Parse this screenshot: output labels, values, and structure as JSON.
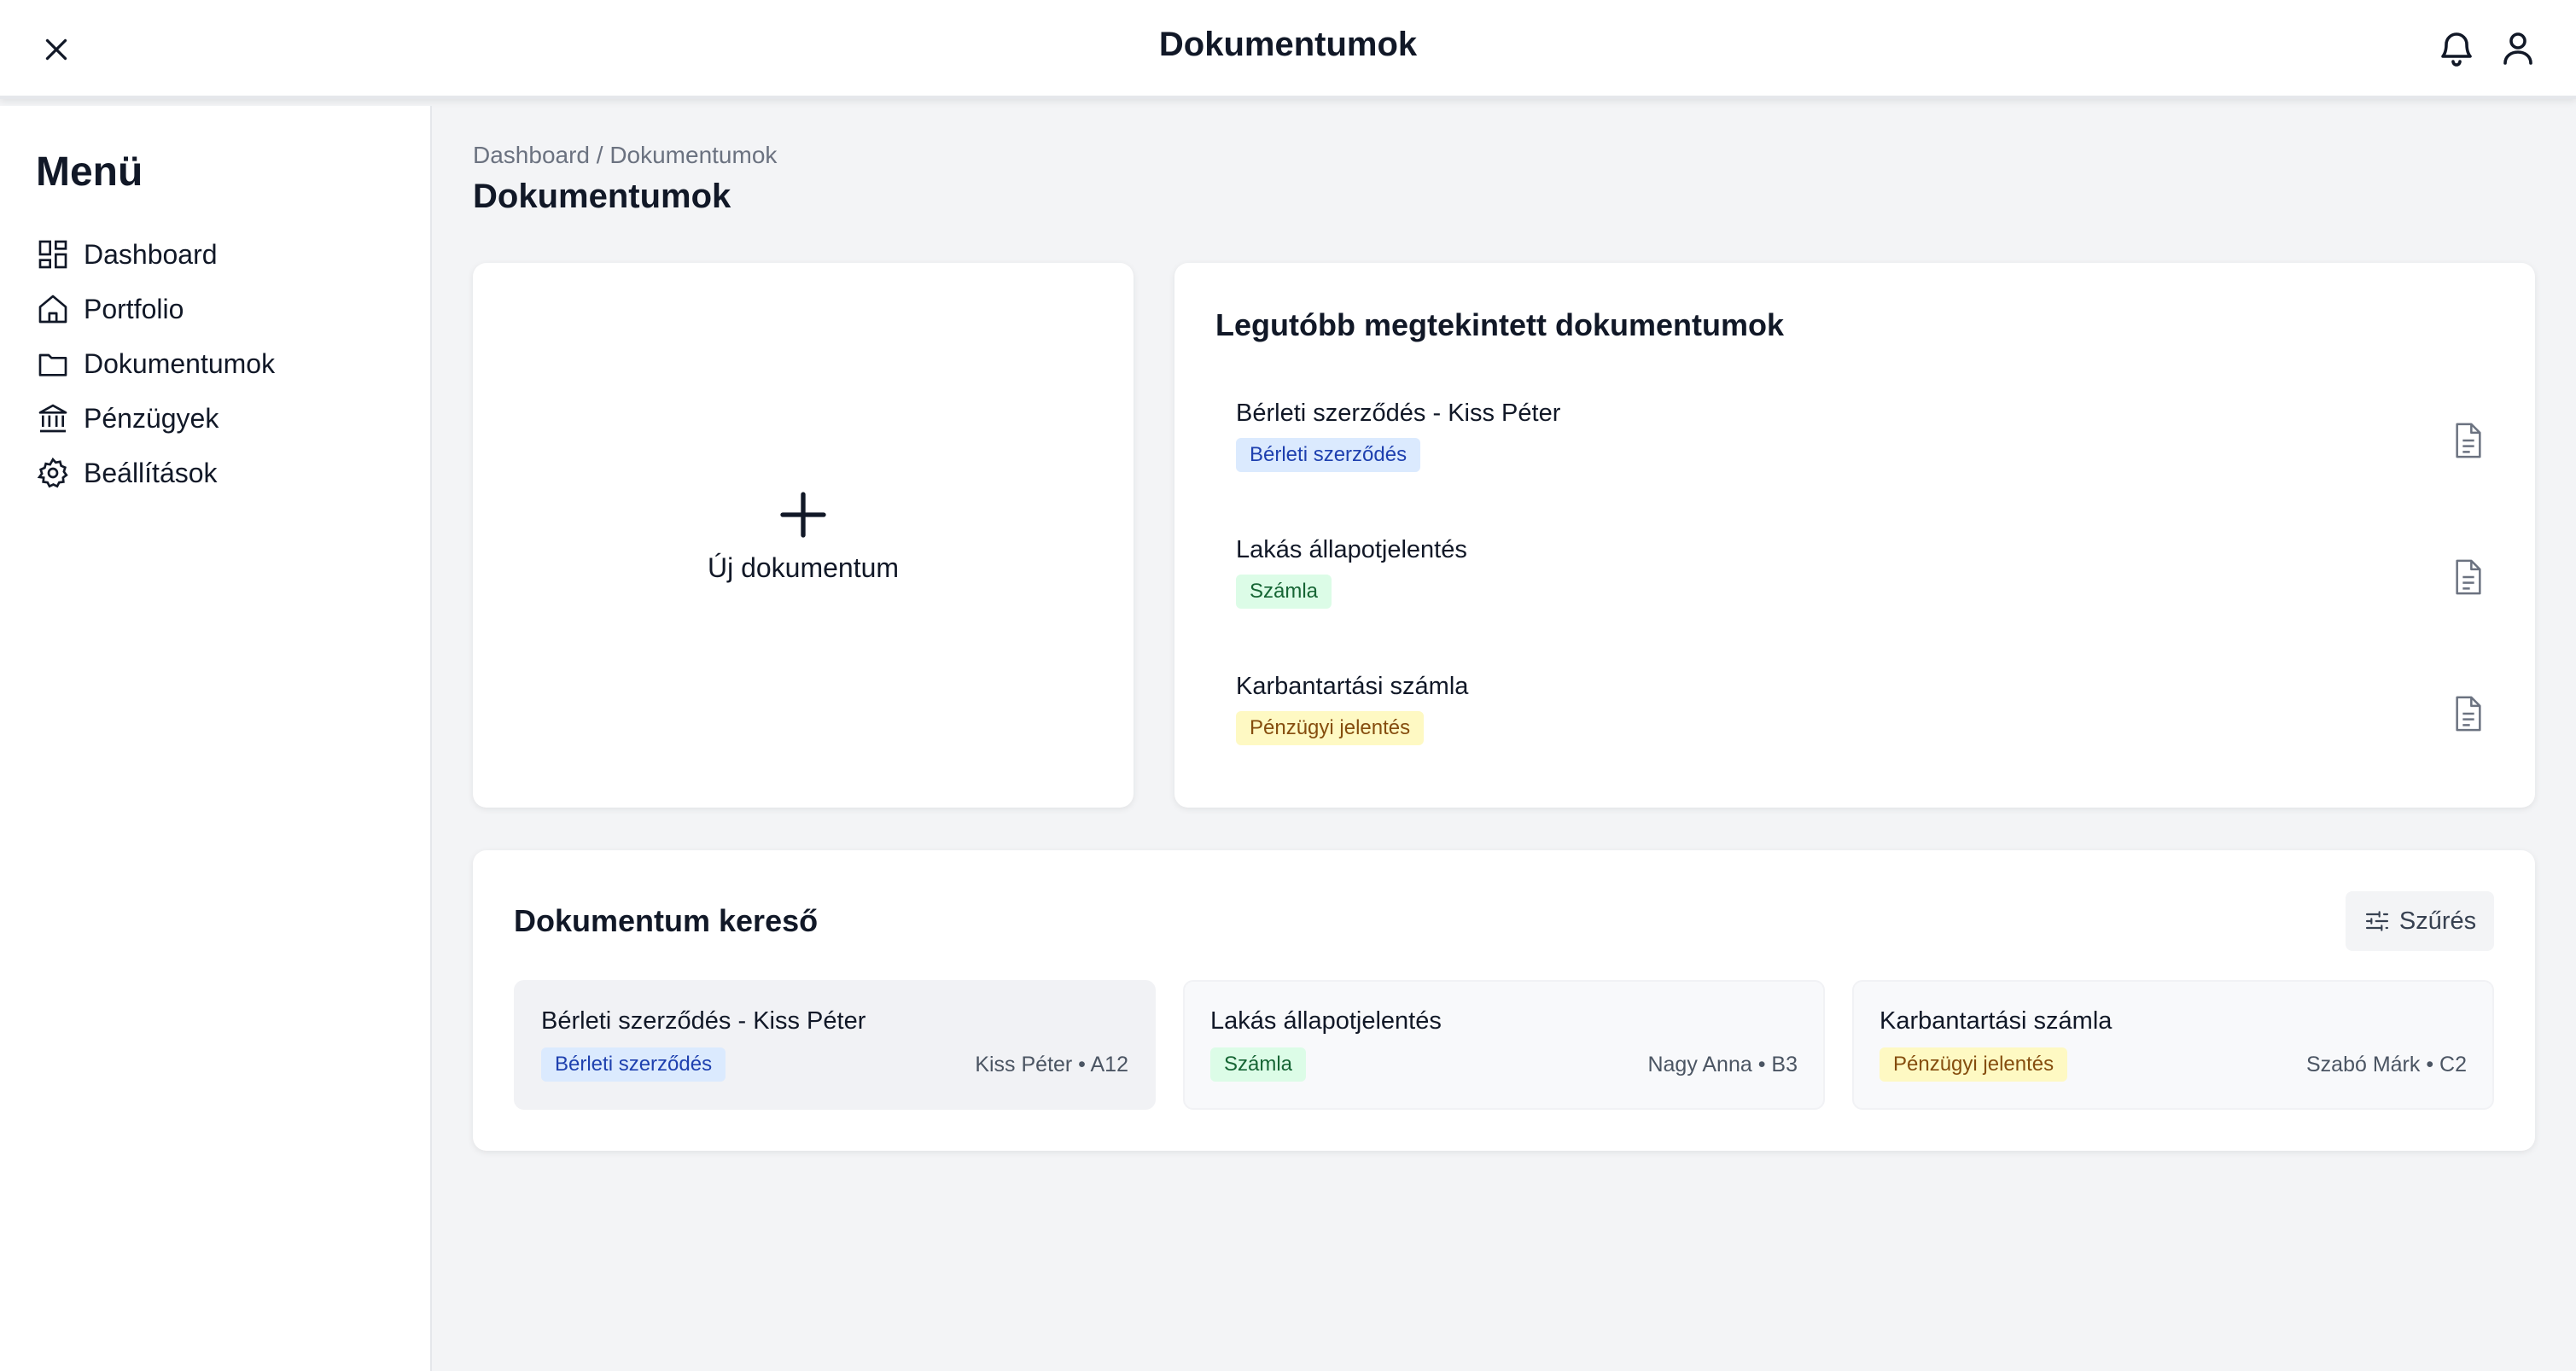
{
  "header": {
    "title": "Dokumentumok"
  },
  "sidebar": {
    "heading": "Menü",
    "items": [
      {
        "label": "Dashboard",
        "icon": "dashboard-icon"
      },
      {
        "label": "Portfolio",
        "icon": "home-icon"
      },
      {
        "label": "Dokumentumok",
        "icon": "folder-icon"
      },
      {
        "label": "Pénzügyek",
        "icon": "bank-icon"
      },
      {
        "label": "Beállítások",
        "icon": "gear-icon"
      }
    ]
  },
  "breadcrumb": "Dashboard / Dokumentumok",
  "page_title": "Dokumentumok",
  "new_document": {
    "label": "Új dokumentum"
  },
  "recent": {
    "title": "Legutóbb megtekintett dokumentumok",
    "items": [
      {
        "name": "Bérleti szerződés - Kiss Péter",
        "tag": "Bérleti szerződés",
        "tag_color": "blue"
      },
      {
        "name": "Lakás állapotjelentés",
        "tag": "Számla",
        "tag_color": "green"
      },
      {
        "name": "Karbantartási számla",
        "tag": "Pénzügyi jelentés",
        "tag_color": "yellow"
      }
    ]
  },
  "search": {
    "title": "Dokumentum kereső",
    "filter_label": "Szűrés",
    "results": [
      {
        "name": "Bérleti szerződés - Kiss Péter",
        "tag": "Bérleti szerződés",
        "tag_color": "blue",
        "meta": "Kiss Péter • A12"
      },
      {
        "name": "Lakás állapotjelentés",
        "tag": "Számla",
        "tag_color": "green",
        "meta": "Nagy Anna • B3"
      },
      {
        "name": "Karbantartási számla",
        "tag": "Pénzügyi jelentés",
        "tag_color": "yellow",
        "meta": "Szabó Márk • C2"
      }
    ]
  },
  "colors": {
    "background": "#f3f4f6",
    "card": "#ffffff",
    "badge_blue": "#dbeafe",
    "badge_green": "#dcfce7",
    "badge_yellow": "#fef9c3"
  }
}
